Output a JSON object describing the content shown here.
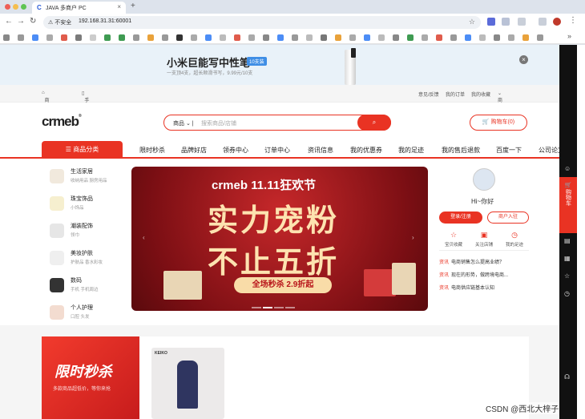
{
  "browser": {
    "tab_title": "JAVA 多商户 PC",
    "tab_favicon": "C",
    "url_warning": "不安全",
    "url": "192.168.31.31:60001",
    "accent_color": "#e93323"
  },
  "ad": {
    "title": "小米巨能写中性笔",
    "badge": "10支装",
    "subtitle": "一支顶4支，超长顺滑书写，9.99元/10支"
  },
  "topbar": {
    "home": "商城首页",
    "mobile": "手机商城",
    "links": [
      "意见/反馈",
      "我的订单",
      "我的收藏",
      "商户入驻"
    ]
  },
  "header": {
    "logo": "crmeb",
    "logo_tm": "®",
    "search_select": "商品",
    "search_placeholder": "搜索商品/店铺",
    "cart": "购物车(0)"
  },
  "nav": {
    "category": "商品分类",
    "items": [
      "限时秒杀",
      "品牌好店",
      "领券中心",
      "订单中心",
      "资讯信息",
      "我的优惠券",
      "我的足迹",
      "我的售后退款",
      "百度一下",
      "公司论文"
    ]
  },
  "categories": [
    {
      "name": "生活家居",
      "sub": "收纳用品  厨房用品"
    },
    {
      "name": "珠宝饰品",
      "sub": "小饰品"
    },
    {
      "name": "潮装配饰",
      "sub": "领巾"
    },
    {
      "name": "美妆护肤",
      "sub": "护肤品  香水彩妆"
    },
    {
      "name": "数码",
      "sub": "手机  手机周边"
    },
    {
      "name": "个人护理",
      "sub": "口腔  头发"
    }
  ],
  "banner": {
    "brand": "crmeb 11.11狂欢节",
    "line1": "实力宠粉",
    "line2": "不止五折",
    "promo": "全场秒杀 2.9折起"
  },
  "user": {
    "greeting": "Hi~你好",
    "login": "登录/注册",
    "register": "商户入驻",
    "quick": [
      "宝贝收藏",
      "关注店铺",
      "我的足迹"
    ],
    "news_tag": "资讯",
    "news": [
      "电商销售怎么提高业绩？",
      "现在的形势，做跨境电商...",
      "电商供应链基本认知"
    ]
  },
  "flash": {
    "title": "限时秒杀",
    "subtitle": "多款商品超低价，等你来抢",
    "product_brand": "KEIKO"
  },
  "sidebar": {
    "cart_label": "购物车"
  },
  "watermark": "CSDN @西北大梓子"
}
